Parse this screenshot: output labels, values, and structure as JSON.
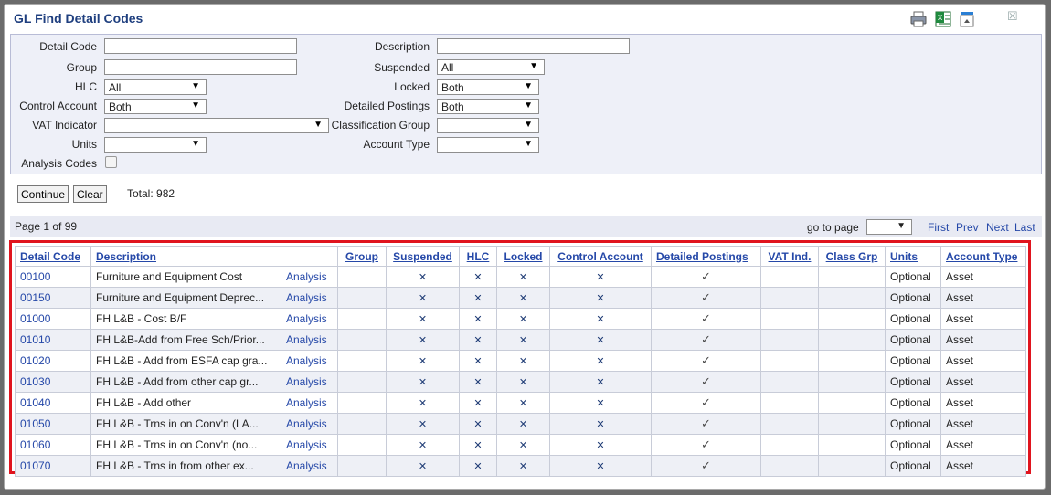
{
  "window": {
    "title": "GL Find Detail Codes",
    "close_glyph": "☒"
  },
  "toolbar_icons": [
    "printer-icon",
    "excel-export-icon",
    "collapse-panel-icon"
  ],
  "criteria": {
    "detail_code": {
      "label": "Detail Code",
      "value": ""
    },
    "group": {
      "label": "Group",
      "value": ""
    },
    "hlc": {
      "label": "HLC",
      "value": "All"
    },
    "control_account": {
      "label": "Control Account",
      "value": "Both"
    },
    "vat_indicator": {
      "label": "VAT Indicator",
      "value": ""
    },
    "units": {
      "label": "Units",
      "value": ""
    },
    "analysis_codes": {
      "label": "Analysis Codes",
      "checked": false
    },
    "description": {
      "label": "Description",
      "value": ""
    },
    "suspended": {
      "label": "Suspended",
      "value": "All"
    },
    "locked": {
      "label": "Locked",
      "value": "Both"
    },
    "detailed_postings": {
      "label": "Detailed Postings",
      "value": "Both"
    },
    "classification_group": {
      "label": "Classification Group",
      "value": ""
    },
    "account_type": {
      "label": "Account Type",
      "value": ""
    }
  },
  "buttons": {
    "continue": "Continue",
    "clear": "Clear"
  },
  "total_text": "Total: 982",
  "pager": {
    "page_text": "Page 1 of 99",
    "goto_label": "go to page",
    "first": "First",
    "prev": "Prev",
    "next": "Next",
    "last": "Last"
  },
  "table": {
    "headers": [
      "Detail Code",
      "Description",
      "",
      "Group",
      "Suspended",
      "HLC",
      "Locked",
      "Control Account",
      "Detailed Postings",
      "VAT Ind.",
      "Class Grp",
      "Units",
      "Account Type"
    ],
    "analysis_label": "Analysis",
    "cross_glyph": "✕",
    "tick_glyph": "✓",
    "rows": [
      {
        "code": "00100",
        "desc": "Furniture and Equipment Cost",
        "units": "Optional",
        "type": "Asset"
      },
      {
        "code": "00150",
        "desc": "Furniture and Equipment Deprec...",
        "units": "Optional",
        "type": "Asset"
      },
      {
        "code": "01000",
        "desc": "FH L&B - Cost B/F",
        "units": "Optional",
        "type": "Asset"
      },
      {
        "code": "01010",
        "desc": "FH L&B-Add from Free Sch/Prior...",
        "units": "Optional",
        "type": "Asset"
      },
      {
        "code": "01020",
        "desc": "FH L&B - Add from ESFA cap gra...",
        "units": "Optional",
        "type": "Asset"
      },
      {
        "code": "01030",
        "desc": "FH L&B - Add from other cap gr...",
        "units": "Optional",
        "type": "Asset"
      },
      {
        "code": "01040",
        "desc": "FH L&B - Add other",
        "units": "Optional",
        "type": "Asset"
      },
      {
        "code": "01050",
        "desc": "FH L&B - Trns in on Conv'n (LA...",
        "units": "Optional",
        "type": "Asset"
      },
      {
        "code": "01060",
        "desc": "FH L&B - Trns in on Conv'n (no...",
        "units": "Optional",
        "type": "Asset"
      },
      {
        "code": "01070",
        "desc": "FH L&B - Trns in from other ex...",
        "units": "Optional",
        "type": "Asset"
      }
    ]
  }
}
